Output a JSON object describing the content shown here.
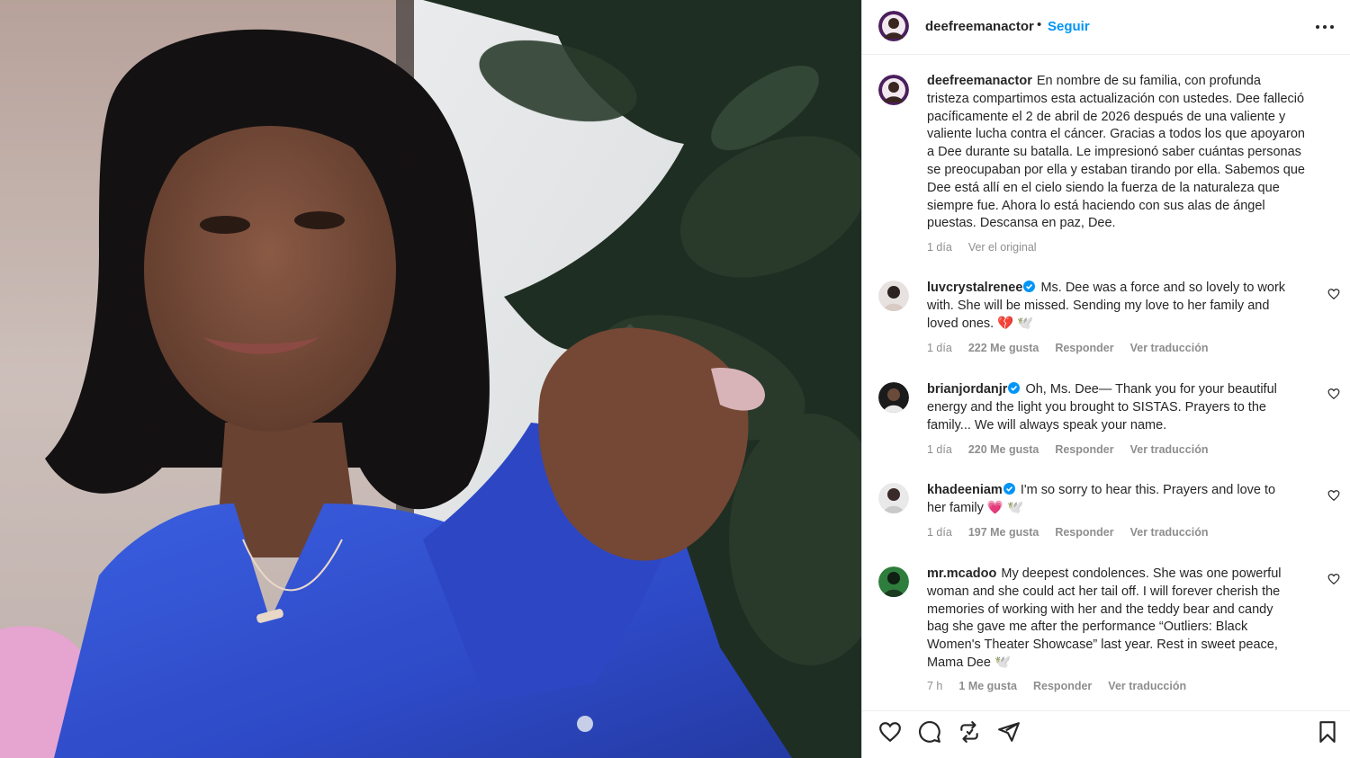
{
  "post": {
    "username": "deefreemanactor",
    "separator": "•",
    "follow_label": "Seguir",
    "more_icon": "more-horizontal-icon"
  },
  "caption": {
    "username": "deefreemanactor",
    "lines": [
      "En nombre de su familia, con profunda",
      "tristeza compartimos esta actualización con ustedes. Dee falleció",
      "pacíficamente el 2 de abril de 2026 después de una valiente y",
      "valiente lucha contra el cáncer. Gracias a todos los que apoyaron",
      "a Dee durante su batalla. Le impresionó saber cuántas personas",
      "se preocupaban por ella y estaban tirando por ella. Sabemos que",
      "Dee está allí en el cielo siendo la fuerza de la naturaleza que",
      "siempre fue. Ahora lo está haciendo con sus alas de ángel",
      "puestas. Descansa en paz, Dee."
    ],
    "time": "1 día",
    "see_original": "Ver el original"
  },
  "comments": [
    {
      "username": "luvcrystalrenee",
      "verified": true,
      "lines": [
        "Ms. Dee was a force and so lovely to work",
        "with. She will be missed. Sending my love to her family and",
        "loved ones. 💔 🕊️"
      ],
      "time": "1 día",
      "likes": "222 Me gusta",
      "reply": "Responder",
      "translate": "Ver traducción"
    },
    {
      "username": "brianjordanjr",
      "verified": true,
      "lines": [
        "Oh, Ms. Dee— Thank you for your beautiful",
        "energy and the light you brought to SISTAS. Prayers to the",
        "family... We will always speak your name."
      ],
      "time": "1 día",
      "likes": "220 Me gusta",
      "reply": "Responder",
      "translate": "Ver traducción"
    },
    {
      "username": "khadeeniam",
      "verified": true,
      "lines": [
        "I'm so sorry to hear this. Prayers and love to",
        "her family 💗 🕊️"
      ],
      "time": "1 día",
      "likes": "197 Me gusta",
      "reply": "Responder",
      "translate": "Ver traducción"
    },
    {
      "username": "mr.mcadoo",
      "verified": false,
      "lines": [
        "My deepest condolences. She was one powerful",
        "woman and she could act her tail off. I will forever cherish the",
        "memories of working with her and the teddy bear and candy",
        "bag she gave me after the performance “Outliers: Black",
        "Women's Theater Showcase” last year. Rest in sweet peace,",
        "Mama Dee 🕊️"
      ],
      "time": "7 h",
      "likes": "1 Me gusta",
      "reply": "Responder",
      "translate": "Ver traducción"
    }
  ],
  "actions": {
    "icons": [
      "heart-icon",
      "comment-icon",
      "repost-icon",
      "share-icon",
      "bookmark-icon"
    ]
  },
  "colors": {
    "follow_blue": "#0095f6",
    "verified_blue": "#0095f6",
    "text": "#262626",
    "secondary_text": "#8e8e8e",
    "dress_blue": "#2f4fcf"
  }
}
